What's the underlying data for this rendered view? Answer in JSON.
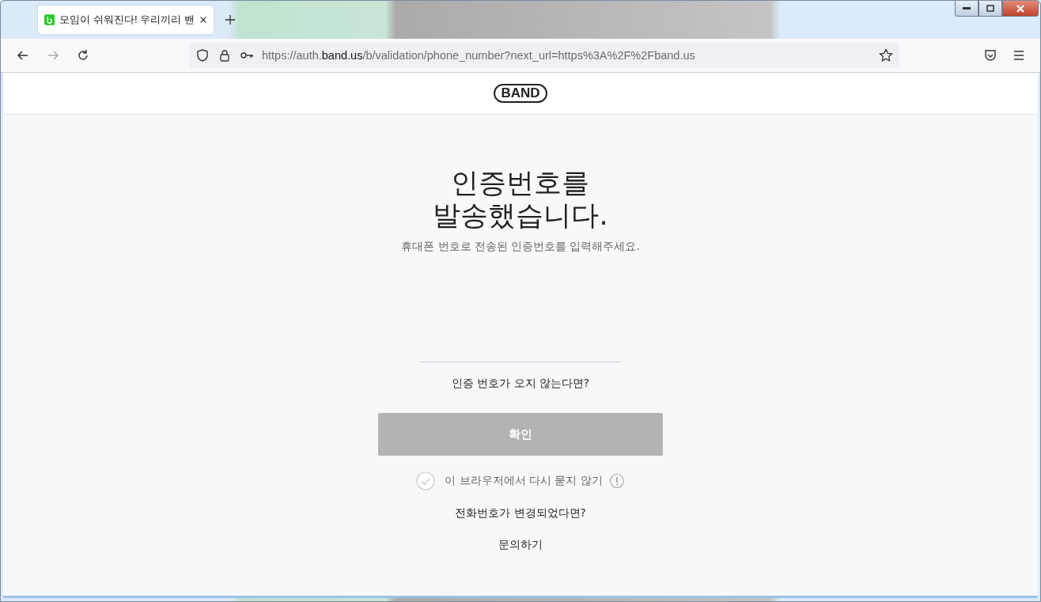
{
  "browser": {
    "tab": {
      "title": "모임이 쉬워진다! 우리끼리 밴",
      "selected": true
    },
    "url": {
      "prefix": "https://auth.",
      "domain": "band.us",
      "path": "/b/validation/phone_number?next_url=https%3A%2F%2Fband.us"
    }
  },
  "page": {
    "logo": "BAND",
    "title": "인증번호를\n발송했습니다.",
    "subtitle": "휴대폰 번호로 전송된 인증번호를 입력해주세요.",
    "no_code_link": "인증 번호가 오지 않는다면?",
    "confirm_button": {
      "label": "확인",
      "disabled": true
    },
    "remember": {
      "label": "이 브라우저에서 다시 묻지 않기",
      "checked": false
    },
    "phone_changed_link": "전화번호가 변경되었다면?",
    "contact_link": "문의하기"
  }
}
